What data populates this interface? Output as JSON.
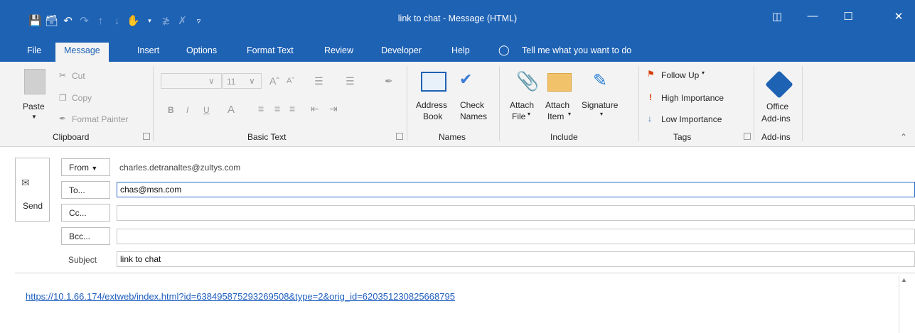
{
  "window": {
    "title": "link to chat  -  Message (HTML)"
  },
  "tabs": [
    "File",
    "Message",
    "Insert",
    "Options",
    "Format Text",
    "Review",
    "Developer",
    "Help"
  ],
  "tell_me": "Tell me what you want to do",
  "clipboard": {
    "paste": "Paste",
    "cut": "Cut",
    "copy": "Copy",
    "format_painter": "Format Painter",
    "label": "Clipboard"
  },
  "basic_text": {
    "font_size": "11",
    "bold": "B",
    "italic": "I",
    "underline": "U",
    "font_color": "A",
    "label": "Basic Text"
  },
  "names": {
    "address": "Address",
    "book": "Book",
    "check": "Check",
    "names": "Names",
    "label": "Names"
  },
  "include": {
    "attach1": "Attach",
    "file": "File",
    "attach2": "Attach",
    "item": "Item",
    "signature": "Signature",
    "label": "Include"
  },
  "tags": {
    "follow_up": "Follow Up",
    "high": "High Importance",
    "low": "Low Importance",
    "label": "Tags"
  },
  "addins": {
    "office": "Office",
    "addins": "Add-ins",
    "label": "Add-ins"
  },
  "compose": {
    "send": "Send",
    "from_label": "From",
    "from_value": "charles.detranaltes@zultys.com",
    "to_label": "To...",
    "to_value": "chas@msn.com",
    "cc_label": "Cc...",
    "bcc_label": "Bcc...",
    "subject_label": "Subject",
    "subject_value": "link to chat"
  },
  "body": {
    "link": "https://10.1.66.174/extweb/index.html?id=638495875293269508&type=2&orig_id=620351230825668795"
  }
}
